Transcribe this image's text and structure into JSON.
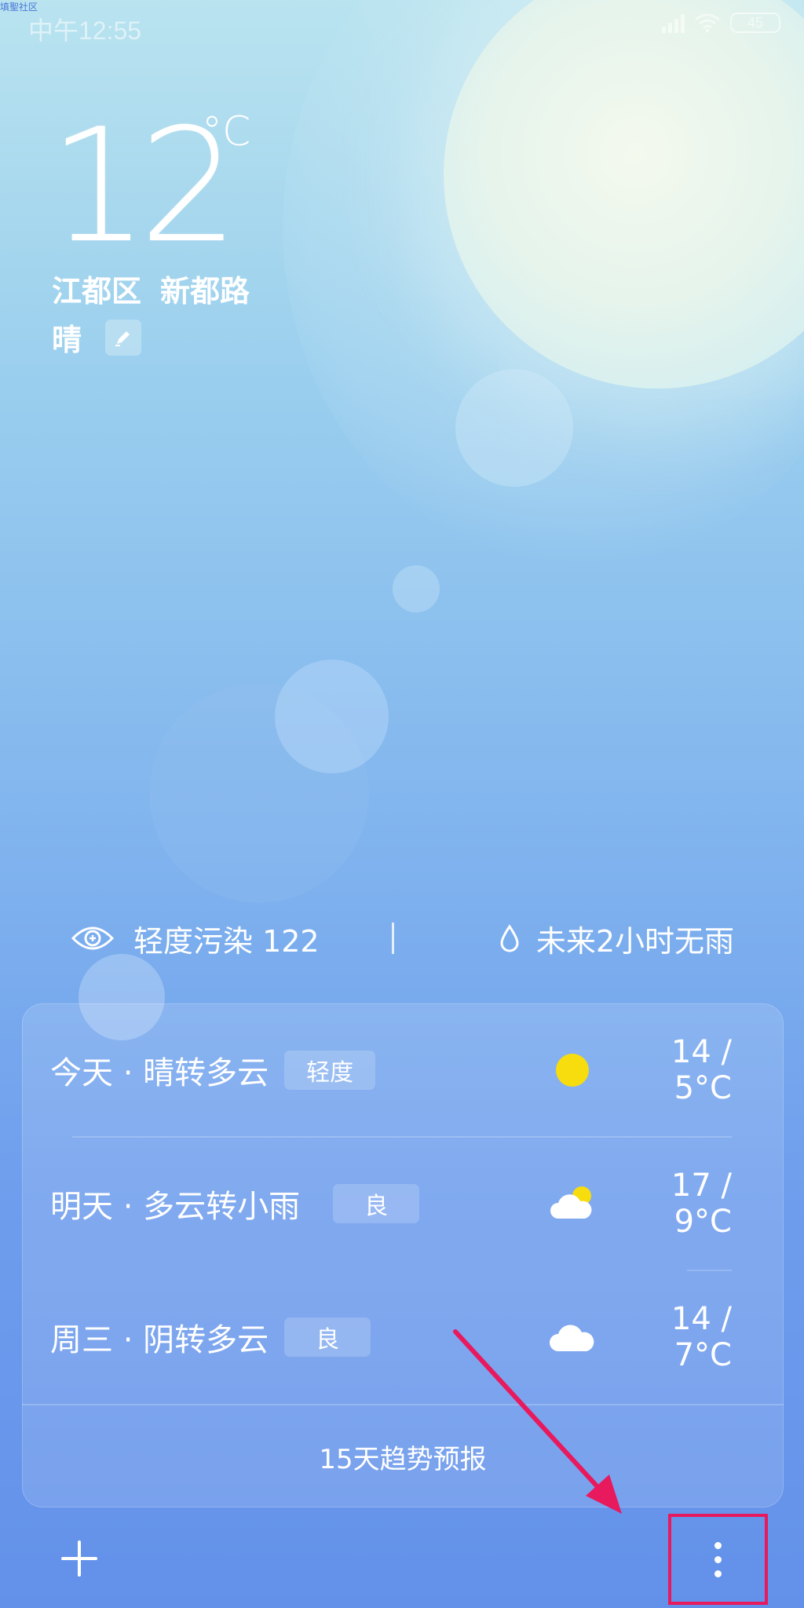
{
  "status_bar": {
    "watermark": "填聖社区",
    "time": "中午12:55",
    "battery": "45"
  },
  "current": {
    "temperature": "12",
    "unit": "°C",
    "district": "江都区",
    "street": "新都路",
    "condition": "晴"
  },
  "info_bar": {
    "aqi_text": "轻度污染 122",
    "rain_text": "未来2小时无雨"
  },
  "forecast": [
    {
      "day": "今天 · 晴转多云",
      "aqi": "轻度",
      "icon": "sun-icon",
      "temps": "14 / 5°C"
    },
    {
      "day": "明天 · 多云转小雨",
      "aqi": "良",
      "icon": "partly-cloudy-icon",
      "temps": "17 / 9°C"
    },
    {
      "day": "周三 · 阴转多云",
      "aqi": "良",
      "icon": "cloud-icon",
      "temps": "14 / 7°C"
    }
  ],
  "trend_link": "15天趋势预报",
  "colors": {
    "highlight": "#e8195c",
    "sun": "#f7dd0e"
  }
}
